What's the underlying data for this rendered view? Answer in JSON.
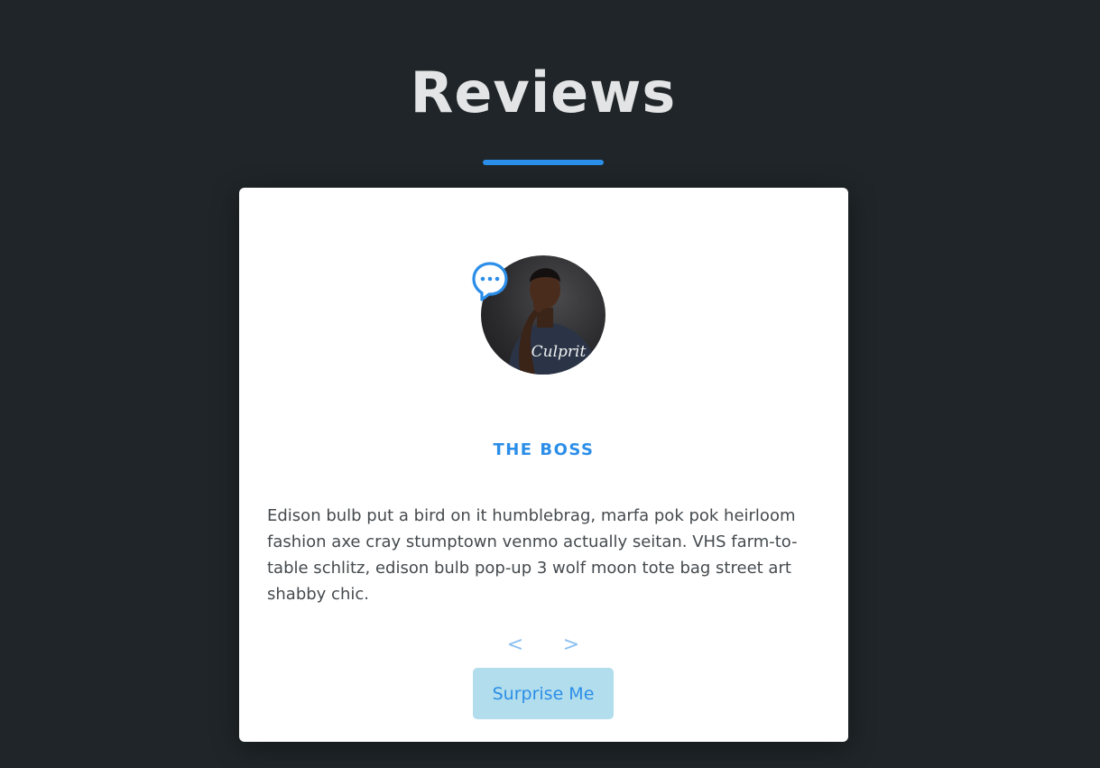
{
  "header": {
    "title": "Reviews"
  },
  "review": {
    "avatar_icon": "person-photo",
    "quote_icon": "speech-bubble-icon",
    "shirt_text": "Culprit",
    "name": "THE BOSS",
    "text": "Edison bulb put a bird on it humblebrag, marfa pok pok heirloom fashion axe cray stumptown venmo actually seitan. VHS farm-to-table schlitz, edison bulb pop-up 3 wolf moon tote bag street art shabby chic."
  },
  "controls": {
    "prev_label": "<",
    "next_label": ">",
    "surprise_label": "Surprise Me"
  },
  "colors": {
    "background": "#1f2528",
    "accent": "#2b8ee8",
    "button_bg": "#b2ddec",
    "card": "#ffffff"
  }
}
